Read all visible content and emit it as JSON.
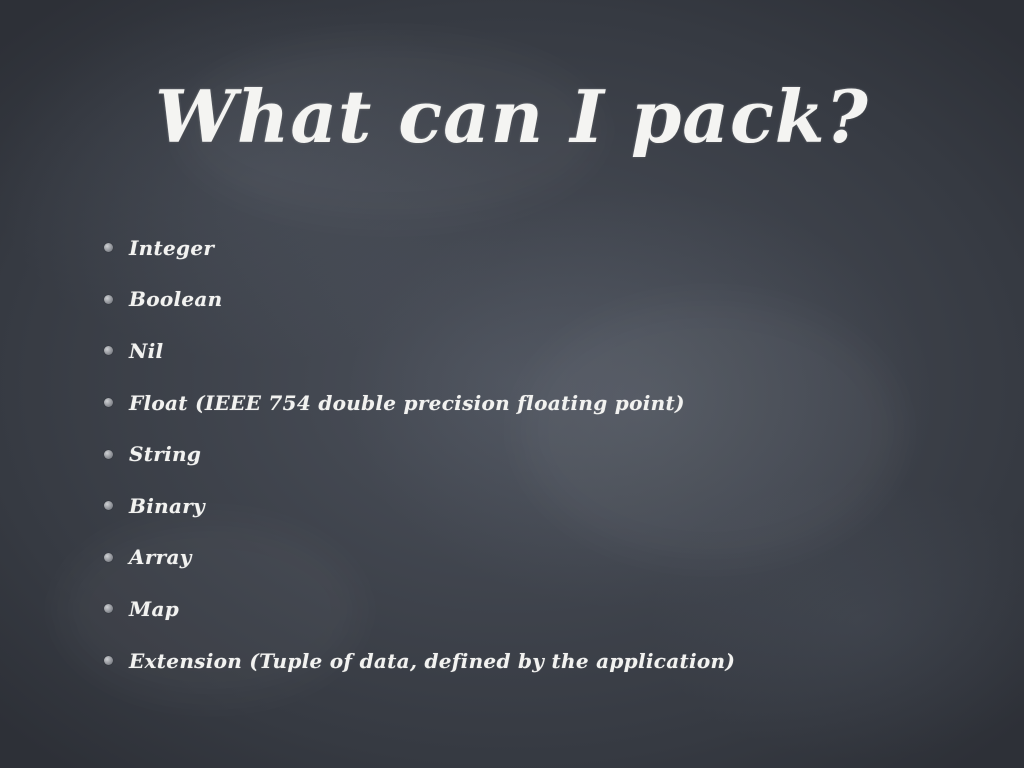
{
  "slide": {
    "title": "What can I pack?",
    "bullets": [
      "Integer",
      "Boolean",
      "Nil",
      "Float (IEEE 754 double precision floating point)",
      "String",
      "Binary",
      "Array",
      "Map",
      "Extension (Tuple of data, defined by the application)"
    ]
  }
}
